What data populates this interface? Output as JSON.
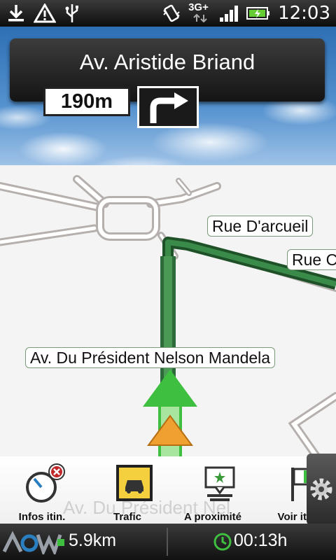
{
  "status_bar": {
    "time": "12:03",
    "network": "3G+",
    "icons": [
      "download-icon",
      "warning-icon",
      "usb-icon",
      "vibrate-icon",
      "signal-icon",
      "battery-charging-icon"
    ]
  },
  "navigation": {
    "current_street": "Av. Aristide Briand",
    "next_turn_distance": "190m",
    "next_turn_direction": "right"
  },
  "map": {
    "street_labels": [
      "Rue D'arcueil",
      "Rue C",
      "Av. Du Président Nelson Mandela"
    ],
    "route_color": "#2e6b3a",
    "arrow_color": "#3fbf3f",
    "position_marker_color": "#f0a030"
  },
  "toolbar": {
    "items": [
      {
        "label": "Infos itin.",
        "icon": "route-info-icon"
      },
      {
        "label": "Trafic",
        "icon": "traffic-icon"
      },
      {
        "label": "A proximité",
        "icon": "nearby-icon"
      },
      {
        "label": "Voir itin.",
        "icon": "view-route-icon"
      }
    ],
    "ghost_text": "Av. Du Président Nel"
  },
  "bottom_bar": {
    "brand": "NAVX",
    "remaining_distance": "5.9km",
    "eta": "00:13h"
  }
}
